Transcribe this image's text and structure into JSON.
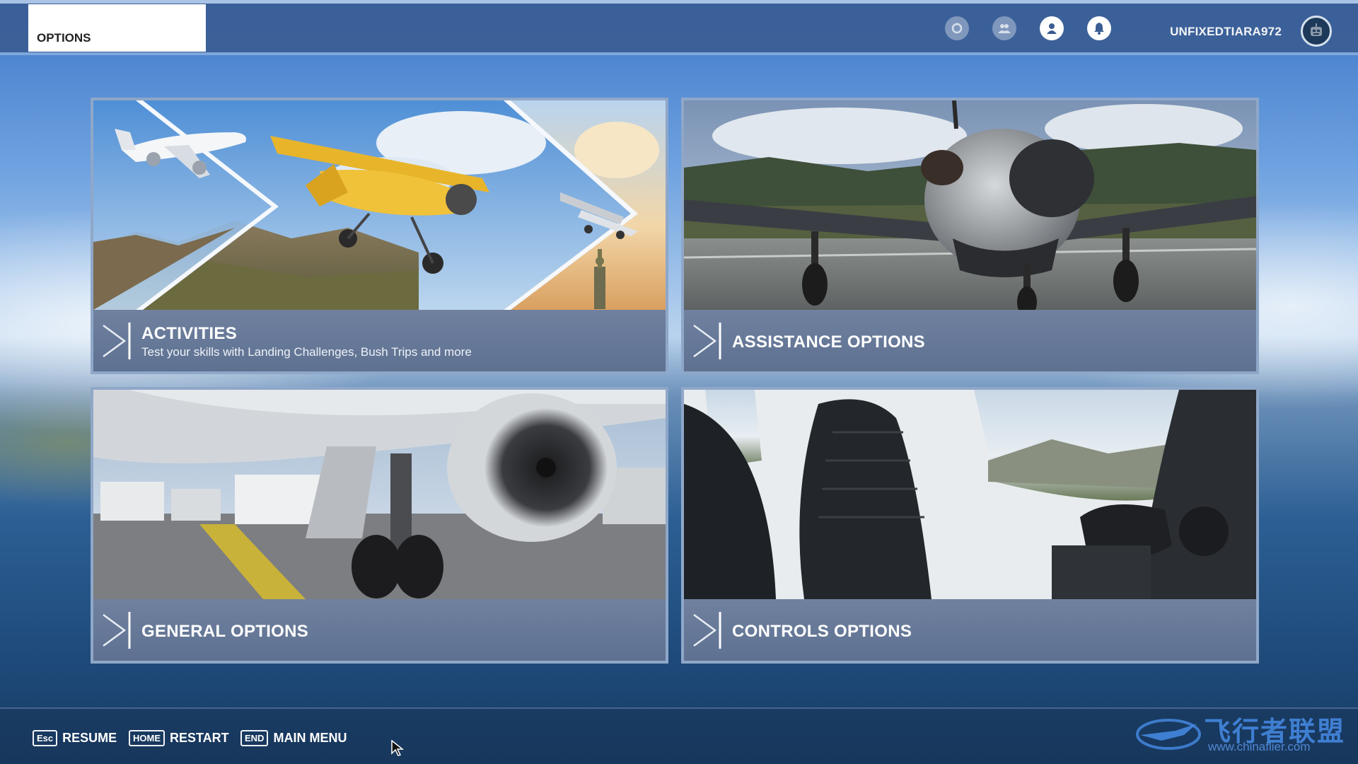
{
  "topbar": {
    "tab_label": "OPTIONS",
    "username": "UNFIXEDTIARA972",
    "icons": [
      "refresh-icon",
      "friends-icon",
      "profile-icon",
      "notification-icon"
    ]
  },
  "cards": [
    {
      "id": "activities",
      "title": "ACTIVITIES",
      "subtitle": "Test your skills with Landing Challenges, Bush Trips and more"
    },
    {
      "id": "assistance",
      "title": "ASSISTANCE OPTIONS"
    },
    {
      "id": "general",
      "title": "GENERAL OPTIONS"
    },
    {
      "id": "controls",
      "title": "CONTROLS OPTIONS"
    }
  ],
  "bottombar": {
    "hints": [
      {
        "key": "Esc",
        "label": "RESUME"
      },
      {
        "key": "HOME",
        "label": "RESTART"
      },
      {
        "key": "END",
        "label": "MAIN MENU"
      }
    ]
  },
  "watermark": {
    "text": "飞行者联盟",
    "url": "www.chinaflier.com"
  },
  "colors": {
    "topbar": "#3a5c92",
    "card_label": "#66799a",
    "accent_border": "#7fa7dc"
  }
}
